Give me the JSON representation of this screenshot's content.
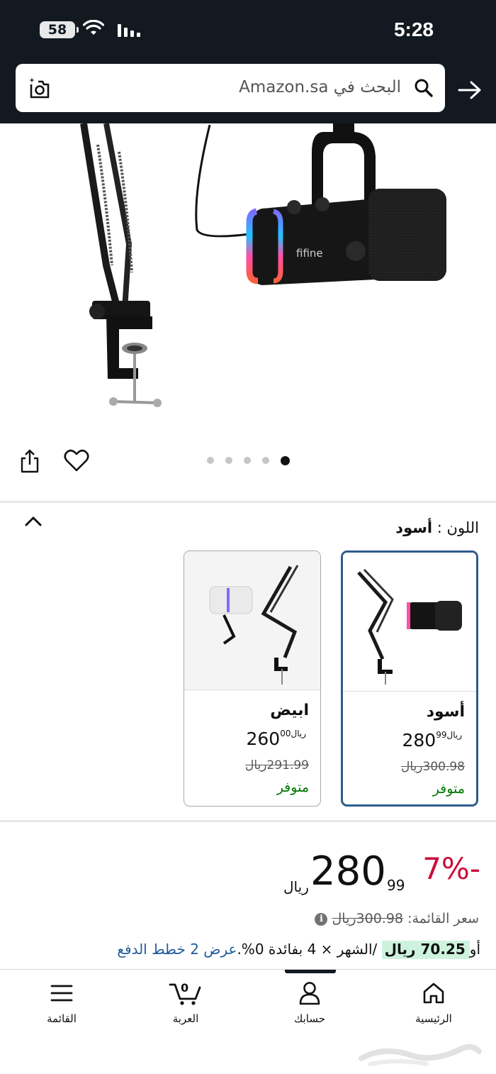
{
  "status_bar": {
    "time": "5:28",
    "battery": "58"
  },
  "header": {
    "search_placeholder": "البحث في Amazon.sa",
    "icons": [
      "camera-icon",
      "search-icon",
      "forward-arrow-icon"
    ]
  },
  "gallery": {
    "brand_on_product": "fifine",
    "dot_count": 5,
    "active_dot": 5
  },
  "variants": {
    "label": "اللون :",
    "selected_value": "أسود",
    "items": [
      {
        "name": "أسود",
        "currency": "ريال",
        "whole": "280",
        "fraction": "99",
        "old_price": "300.98ريال",
        "availability": "متوفر",
        "selected": true
      },
      {
        "name": "ابيض",
        "currency": "ريال",
        "whole": "260",
        "fraction": "00",
        "old_price": "291.99ريال",
        "availability": "متوفر",
        "selected": false
      }
    ]
  },
  "price": {
    "discount": "-7%",
    "currency": "ريال",
    "whole": "280",
    "fraction": "99",
    "list_label": "سعر القائمة:",
    "list_value": "300.98ريال",
    "installment_prefix": "أو",
    "installment_amount": "70.25 ريال",
    "installment_text": " /الشهر × 4 بفائدة 0%.",
    "installment_link": "عرض 2 خطط الدفع"
  },
  "bottom_nav": {
    "items": [
      {
        "label": "الرئيسية",
        "icon": "home-icon"
      },
      {
        "label": "حسابك",
        "icon": "account-icon"
      },
      {
        "label": "العربة",
        "icon": "cart-icon",
        "count": "0"
      },
      {
        "label": "القائمة",
        "icon": "menu-icon"
      }
    ]
  },
  "colors": {
    "header_bg": "#131921",
    "discount": "#cc0c39",
    "available": "#007600",
    "link": "#1f5c99",
    "selected_border": "#2e5c8d"
  }
}
